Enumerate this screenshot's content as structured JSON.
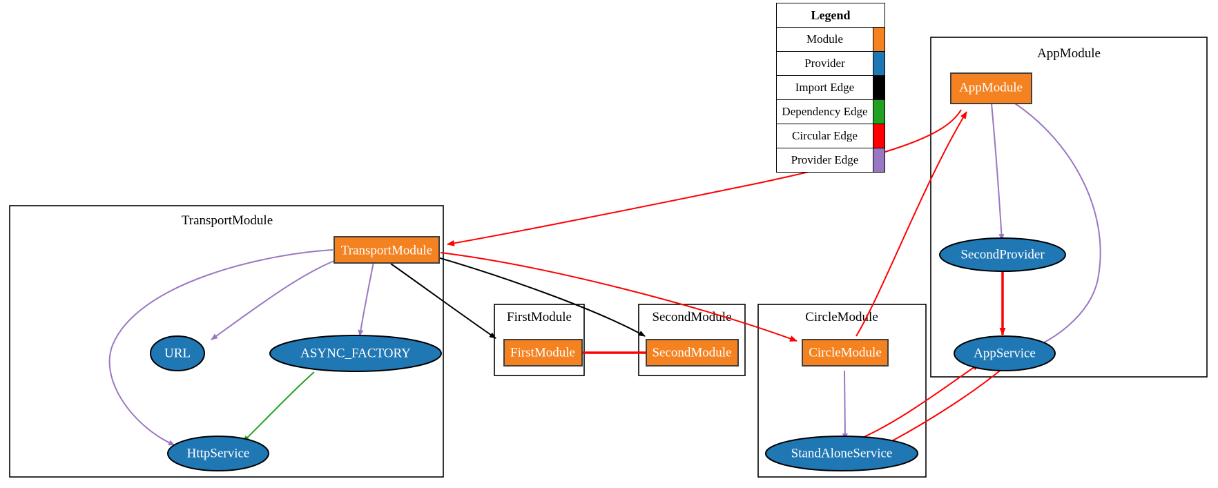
{
  "legend": {
    "title": "Legend",
    "rows": [
      {
        "label": "Module",
        "color": "#f58220"
      },
      {
        "label": "Provider",
        "color": "#1f77b4"
      },
      {
        "label": "Import Edge",
        "color": "#000000"
      },
      {
        "label": "Dependency Edge",
        "color": "#22a022"
      },
      {
        "label": "Circular Edge",
        "color": "#ff0000"
      },
      {
        "label": "Provider Edge",
        "color": "#9a77c2"
      }
    ]
  },
  "clusters": [
    {
      "id": "transport",
      "label": "TransportModule"
    },
    {
      "id": "first",
      "label": "FirstModule"
    },
    {
      "id": "second",
      "label": "SecondModule"
    },
    {
      "id": "circle",
      "label": "CircleModule"
    },
    {
      "id": "app",
      "label": "AppModule"
    }
  ],
  "nodes": [
    {
      "id": "transportModule",
      "label": "TransportModule",
      "shape": "rect",
      "color": "#f58220"
    },
    {
      "id": "url",
      "label": "URL",
      "shape": "ellipse",
      "color": "#1f77b4"
    },
    {
      "id": "asyncFactory",
      "label": "ASYNC_FACTORY",
      "shape": "ellipse",
      "color": "#1f77b4"
    },
    {
      "id": "httpService",
      "label": "HttpService",
      "shape": "ellipse",
      "color": "#1f77b4"
    },
    {
      "id": "firstModule",
      "label": "FirstModule",
      "shape": "rect",
      "color": "#f58220"
    },
    {
      "id": "secondModule",
      "label": "SecondModule",
      "shape": "rect",
      "color": "#f58220"
    },
    {
      "id": "circleModule",
      "label": "CircleModule",
      "shape": "rect",
      "color": "#f58220"
    },
    {
      "id": "standAloneService",
      "label": "StandAloneService",
      "shape": "ellipse",
      "color": "#1f77b4"
    },
    {
      "id": "appModule",
      "label": "AppModule",
      "shape": "rect",
      "color": "#f58220"
    },
    {
      "id": "secondProvider",
      "label": "SecondProvider",
      "shape": "ellipse",
      "color": "#1f77b4"
    },
    {
      "id": "appService",
      "label": "AppService",
      "shape": "ellipse",
      "color": "#1f77b4"
    }
  ],
  "edges": [
    {
      "from": "transportModule",
      "to": "url",
      "kind": "provider"
    },
    {
      "from": "transportModule",
      "to": "asyncFactory",
      "kind": "provider"
    },
    {
      "from": "transportModule",
      "to": "httpService",
      "kind": "provider"
    },
    {
      "from": "asyncFactory",
      "to": "httpService",
      "kind": "dependency"
    },
    {
      "from": "transportModule",
      "to": "firstModule",
      "kind": "import"
    },
    {
      "from": "transportModule",
      "to": "secondModule",
      "kind": "import"
    },
    {
      "from": "transportModule",
      "to": "circleModule",
      "kind": "circular"
    },
    {
      "from": "appModule",
      "to": "transportModule",
      "kind": "circular"
    },
    {
      "from": "firstModule",
      "to": "secondModule",
      "kind": "circular-both"
    },
    {
      "from": "circleModule",
      "to": "standAloneService",
      "kind": "provider"
    },
    {
      "from": "circleModule",
      "to": "appModule",
      "kind": "circular"
    },
    {
      "from": "appModule",
      "to": "secondProvider",
      "kind": "provider"
    },
    {
      "from": "appModule",
      "to": "appService",
      "kind": "provider"
    },
    {
      "from": "secondProvider",
      "to": "appService",
      "kind": "circular-both"
    },
    {
      "from": "standAloneService",
      "to": "appService",
      "kind": "circular-both"
    }
  ]
}
